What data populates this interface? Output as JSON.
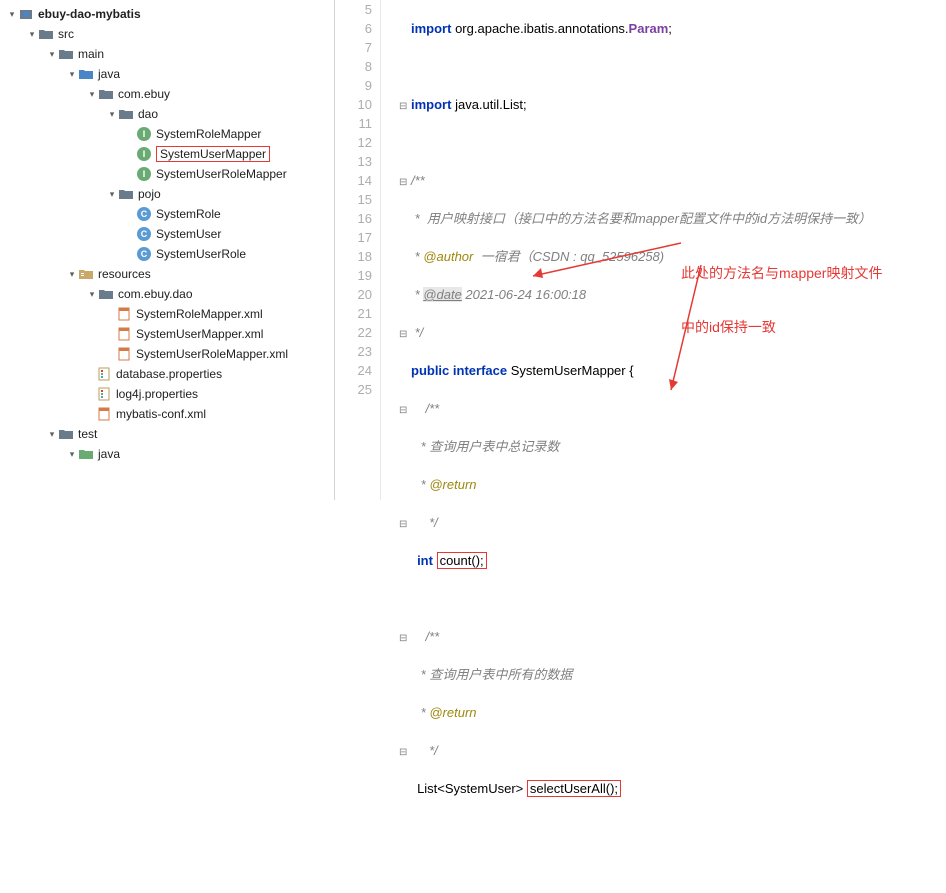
{
  "project": {
    "root": "ebuy-dao-mybatis",
    "src": "src",
    "main": "main",
    "java": "java",
    "pkg": "com.ebuy",
    "dao": "dao",
    "srm": "SystemRoleMapper",
    "sum": "SystemUserMapper",
    "surm": "SystemUserRoleMapper",
    "pojo": "pojo",
    "sr": "SystemRole",
    "su": "SystemUser",
    "sur": "SystemUserRole",
    "resources": "resources",
    "res_pkg": "com.ebuy.dao",
    "srm_xml": "SystemRoleMapper.xml",
    "sum_xml": "SystemUserMapper.xml",
    "surm_xml": "SystemUserRoleMapper.xml",
    "db_prop": "database.properties",
    "log4j": "log4j.properties",
    "mybatis": "mybatis-conf.xml",
    "test": "test",
    "test_java": "java"
  },
  "lines": [
    "5",
    "6",
    "7",
    "8",
    "9",
    "10",
    "11",
    "12",
    "13",
    "14",
    "15",
    "16",
    "17",
    "18",
    "19",
    "20",
    "21",
    "22",
    "23",
    "24",
    "25"
  ],
  "code": {
    "l5_import": "import",
    "l5_pkg": "org.apache.ibatis.annotations.",
    "l5_cls": "Param",
    "l7_import": "import",
    "l7_pkg": "java.util.List;",
    "l9": "/**",
    "l10": " *  用户映射接口（接口中的方法名要和mapper配置文件中的id方法明保持一致）",
    "l11_a": " * ",
    "l11_tag": "@author",
    "l11_b": "  一宿君（CSDN : qq_52596258)",
    "l12_a": " * ",
    "l12_tag": "@date",
    "l12_b": " 2021-06-24 16:00:18",
    "l13": " */",
    "l14_pub": "public",
    "l14_int": "interface",
    "l14_name": "SystemUserMapper {",
    "l15": "/**",
    "l16": " * 查询用户表中总记录数",
    "l17_a": " * ",
    "l17_tag": "@return",
    "l18": " */",
    "l19_int": "int",
    "l19_m": "count();",
    "l21": "/**",
    "l22": " * 查询用户表中所有的数据",
    "l23_a": " * ",
    "l23_tag": "@return",
    "l24": " */",
    "l25_list": "List<SystemUser>",
    "l25_m": "selectUserAll();"
  },
  "annotation": {
    "line1": "此处的方法名与mapper映射文件",
    "line2": "中的id保持一致"
  }
}
